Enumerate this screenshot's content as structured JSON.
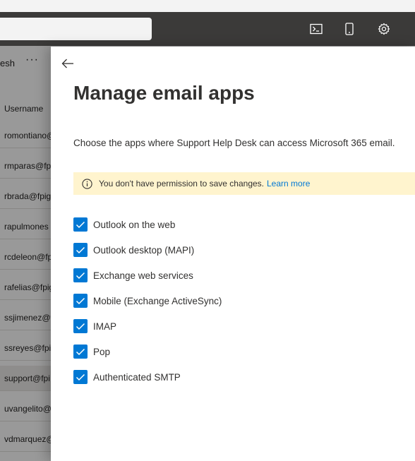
{
  "background": {
    "toolbar": {
      "refresh_label": "esh",
      "more_label": "···"
    },
    "column_header": "Username",
    "rows": [
      {
        "username": "romontiano@"
      },
      {
        "username": "rmparas@fp"
      },
      {
        "username": "rbrada@fpig"
      },
      {
        "username": "rapulmones"
      },
      {
        "username": "rcdeleon@fp"
      },
      {
        "username": "rafelias@fpig"
      },
      {
        "username": "ssjimenez@f"
      },
      {
        "username": "ssreyes@fpig"
      },
      {
        "username": "support@fpi"
      },
      {
        "username": "uvangelito@"
      },
      {
        "username": "vdmarquez@"
      }
    ]
  },
  "header": {
    "icons": [
      "terminal-icon",
      "mobile-icon",
      "gear-icon"
    ]
  },
  "panel": {
    "title": "Manage email apps",
    "description": "Choose the apps where Support Help Desk can access Microsoft 365 email.",
    "banner": {
      "message": "You don't have permission to save changes.",
      "link": "Learn more",
      "color": "#fff4ce"
    },
    "options": [
      {
        "label": "Outlook on the web",
        "checked": true
      },
      {
        "label": "Outlook desktop (MAPI)",
        "checked": true
      },
      {
        "label": "Exchange web services",
        "checked": true
      },
      {
        "label": "Mobile (Exchange ActiveSync)",
        "checked": true
      },
      {
        "label": "IMAP",
        "checked": true
      },
      {
        "label": "Pop",
        "checked": true
      },
      {
        "label": "Authenticated SMTP",
        "checked": true
      }
    ],
    "accent_color": "#0078d4"
  }
}
